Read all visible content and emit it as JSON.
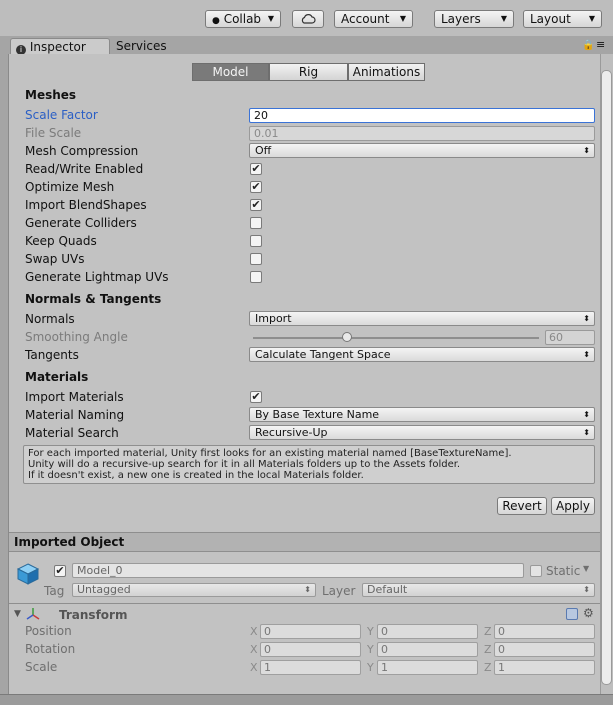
{
  "toolbar": {
    "collab": "Collab",
    "account": "Account",
    "layers": "Layers",
    "layout": "Layout"
  },
  "tabs": {
    "inspector": "Inspector",
    "services": "Services"
  },
  "segments": [
    "Model",
    "Rig",
    "Animations"
  ],
  "meshes": {
    "title": "Meshes",
    "scale_factor_label": "Scale Factor",
    "scale_factor": "20",
    "file_scale_label": "File Scale",
    "file_scale": "0.01",
    "mesh_compression_label": "Mesh Compression",
    "mesh_compression": "Off",
    "read_write_label": "Read/Write Enabled",
    "optimize_label": "Optimize Mesh",
    "blendshapes_label": "Import BlendShapes",
    "colliders_label": "Generate Colliders",
    "quads_label": "Keep Quads",
    "swap_uvs_label": "Swap UVs",
    "lightmap_label": "Generate Lightmap UVs"
  },
  "normals": {
    "title": "Normals & Tangents",
    "normals_label": "Normals",
    "normals_value": "Import",
    "smoothing_label": "Smoothing Angle",
    "smoothing_value": "60",
    "smoothing_fraction": 0.33,
    "tangents_label": "Tangents",
    "tangents_value": "Calculate Tangent Space"
  },
  "materials": {
    "title": "Materials",
    "import_label": "Import Materials",
    "naming_label": "Material Naming",
    "naming_value": "By Base Texture Name",
    "search_label": "Material Search",
    "search_value": "Recursive-Up",
    "help_1": "For each imported material, Unity first looks for an existing material named [BaseTextureName].",
    "help_2": "Unity will do a recursive-up search for it in all Materials folders up to the Assets folder.",
    "help_3": "If it doesn't exist, a new one is created in the local Materials folder."
  },
  "buttons": {
    "revert": "Revert",
    "apply": "Apply"
  },
  "imported_object": {
    "title": "Imported Object",
    "name": "Model_0",
    "static_label": "Static",
    "tag_label": "Tag",
    "tag_value": "Untagged",
    "layer_label": "Layer",
    "layer_value": "Default"
  },
  "transform": {
    "title": "Transform",
    "position_label": "Position",
    "rotation_label": "Rotation",
    "scale_label": "Scale",
    "x": "X",
    "y": "Y",
    "z": "Z",
    "position": [
      "0",
      "0",
      "0"
    ],
    "rotation": [
      "0",
      "0",
      "0"
    ],
    "scale": [
      "1",
      "1",
      "1"
    ]
  },
  "colors": {
    "focus": "#3b73d6",
    "panel": "#c2c2c2",
    "selected_segment": "#7a7a7a"
  }
}
